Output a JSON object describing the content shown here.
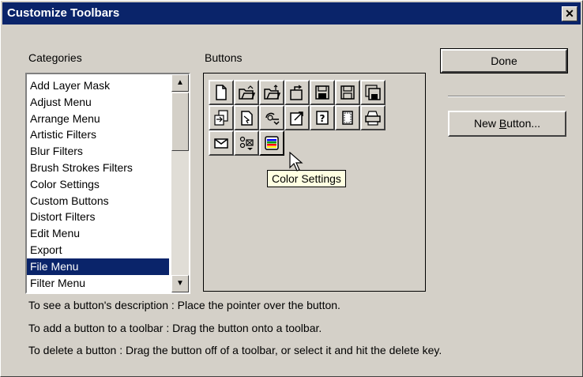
{
  "window": {
    "title": "Customize Toolbars",
    "close_glyph": "✕"
  },
  "categories": {
    "label": "Categories",
    "items": [
      "Add Layer Mask",
      "Adjust Menu",
      "Arrange Menu",
      "Artistic Filters",
      "Blur Filters",
      "Brush Strokes Filters",
      "Color Settings",
      "Custom Buttons",
      "Distort Filters",
      "Edit Menu",
      "Export",
      "File Menu",
      "Filter Menu"
    ],
    "selected": "File Menu",
    "scroll_up_glyph": "▲",
    "scroll_down_glyph": "▼"
  },
  "buttons": {
    "label": "Buttons",
    "icons": [
      "new-document-icon",
      "open-icon",
      "open-alt-icon",
      "revert-icon",
      "save-icon",
      "save-as-icon",
      "save-all-icon",
      "import-icon",
      "place-icon",
      "acquire-icon",
      "export-icon",
      "file-info-icon",
      "page-setup-icon",
      "print-icon",
      "mail-icon",
      "scan-icon",
      "color-settings-icon"
    ]
  },
  "tooltip": "Color Settings",
  "actions": {
    "done": "Done",
    "new_button": "New Button..."
  },
  "help": {
    "line1": "To see a button's description : Place the pointer over the button.",
    "line2": "To add a button to a toolbar : Drag the button onto a toolbar.",
    "line3": "To delete a button : Drag the button off of a toolbar, or select it and hit the delete key."
  }
}
